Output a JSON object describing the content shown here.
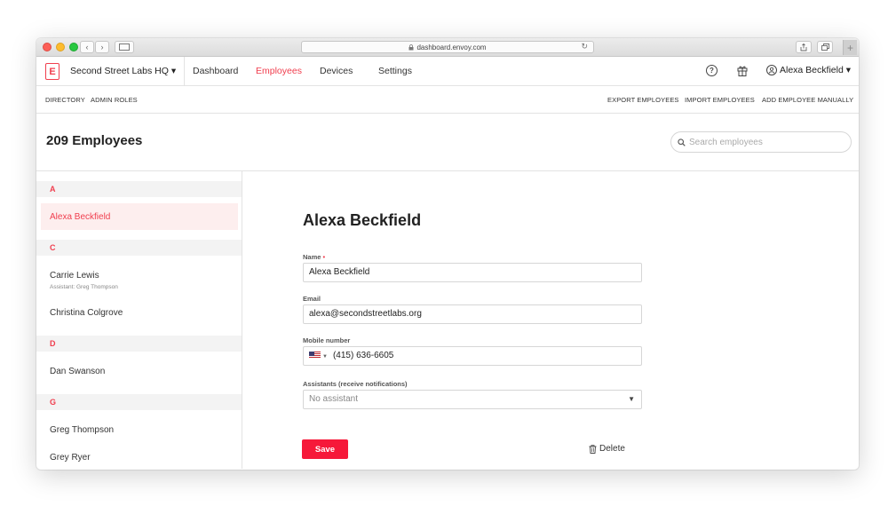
{
  "browser": {
    "url": "dashboard.envoy.com",
    "lock_icon": "lock-icon",
    "back_glyph": "‹",
    "forward_glyph": "›",
    "newtab_glyph": "+"
  },
  "topnav": {
    "logo_letter": "E",
    "location": "Second Street Labs HQ ▾",
    "links": [
      "Dashboard",
      "Employees",
      "Devices",
      "Settings"
    ],
    "active_link": "Employees",
    "user": "Alexa Beckfield ▾",
    "help_glyph": "?"
  },
  "subnav": {
    "left": [
      "DIRECTORY",
      "ADMIN ROLES"
    ],
    "right": [
      "EXPORT EMPLOYEES",
      "IMPORT EMPLOYEES",
      "ADD EMPLOYEE MANUALLY"
    ]
  },
  "page": {
    "title": "209 Employees",
    "search_placeholder": "Search employees"
  },
  "list": {
    "groups": [
      {
        "letter": "A",
        "employees": [
          {
            "name": "Alexa Beckfield",
            "selected": true
          }
        ]
      },
      {
        "letter": "C",
        "employees": [
          {
            "name": "Carrie Lewis",
            "sub": "Assistant: Greg Thompson"
          },
          {
            "name": "Christina Colgrove"
          }
        ]
      },
      {
        "letter": "D",
        "employees": [
          {
            "name": "Dan Swanson"
          }
        ]
      },
      {
        "letter": "G",
        "employees": [
          {
            "name": "Greg Thompson"
          },
          {
            "name": "Grey Ryer"
          }
        ]
      }
    ]
  },
  "detail": {
    "title": "Alexa Beckfield",
    "name_label": "Name",
    "required_mark": "•",
    "name_value": "Alexa Beckfield",
    "email_label": "Email",
    "email_value": "alexa@secondstreetlabs.org",
    "mobile_label": "Mobile number",
    "mobile_value": "(415) 636-6605",
    "assistants_label": "Assistants (receive notifications)",
    "assistants_value": "No assistant",
    "save_label": "Save",
    "delete_label": "Delete"
  }
}
